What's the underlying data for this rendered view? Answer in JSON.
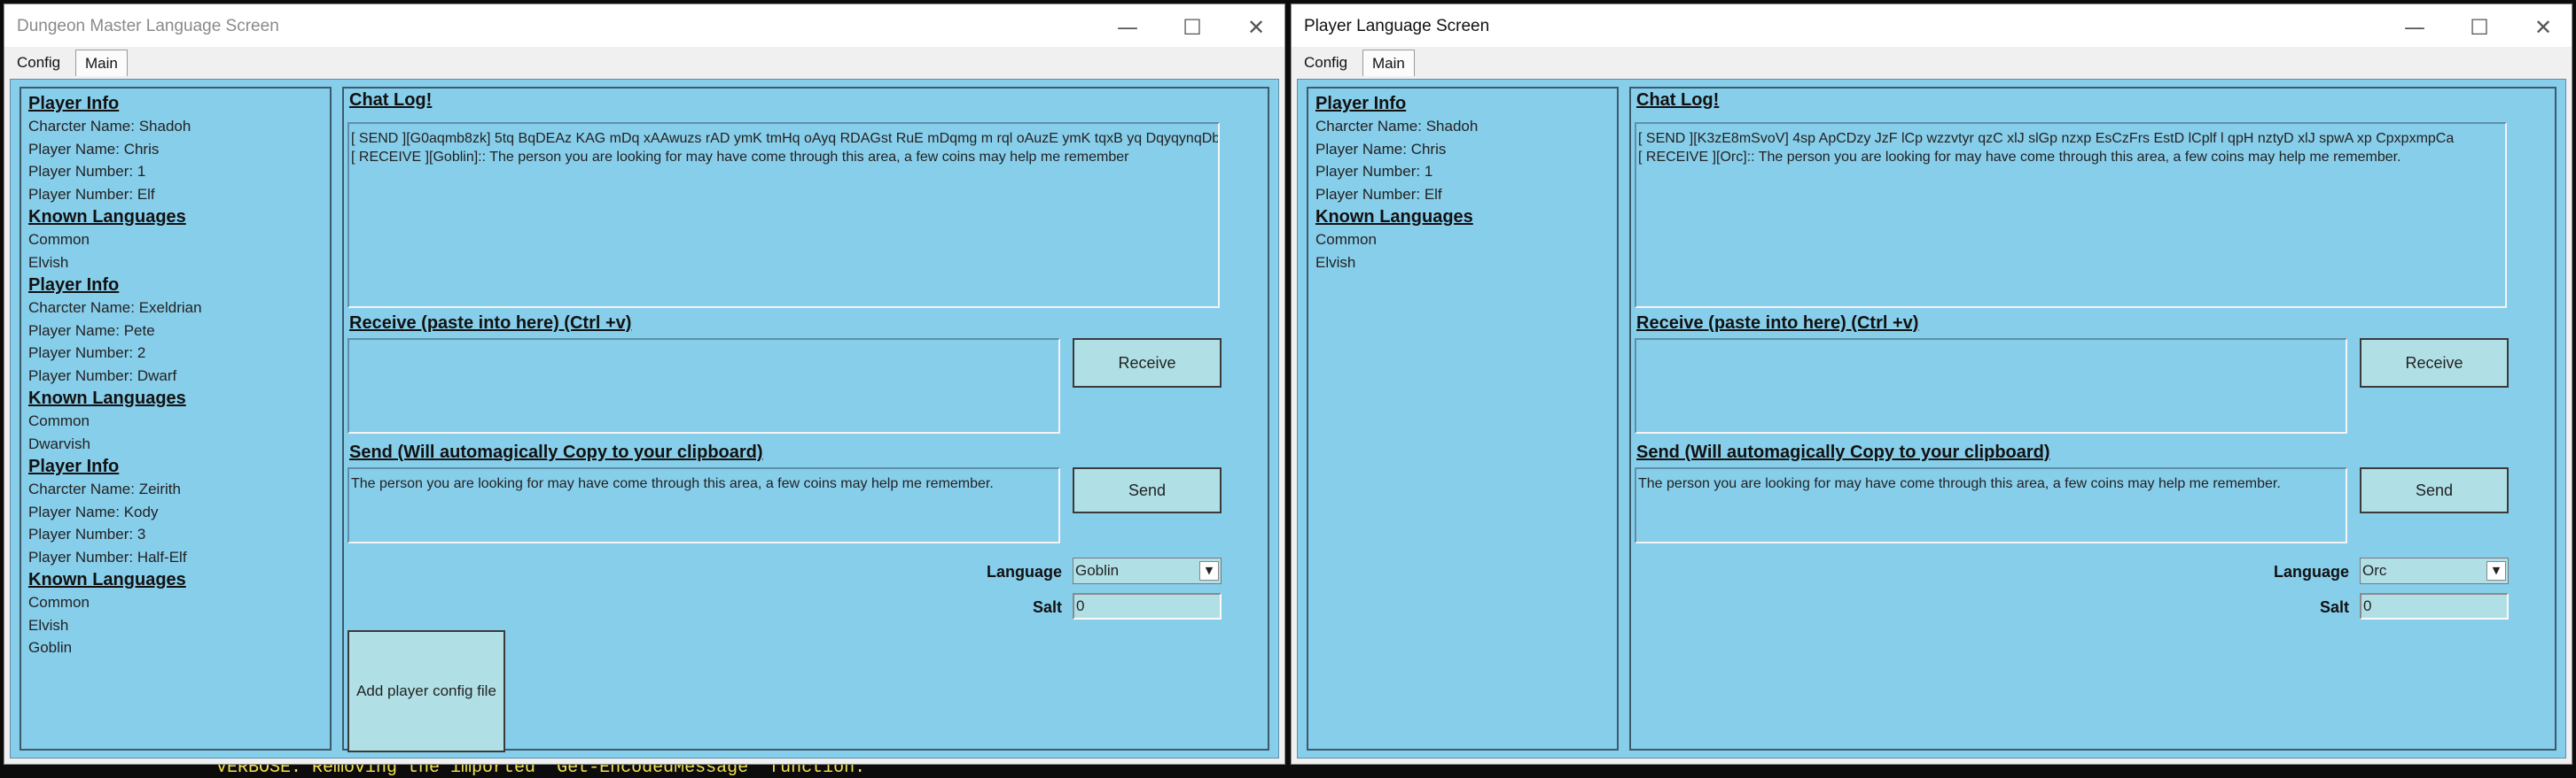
{
  "background_console_text": "VERBOSE: Removing the imported \"Get-EncodedMessage\" function.",
  "dm_window": {
    "title": "Dungeon Master Language Screen",
    "controls": {
      "minimize": "—",
      "maximize": "☐",
      "close": "✕"
    },
    "tabs": {
      "config": "Config",
      "main": "Main"
    },
    "players": [
      {
        "heading": "Player Info",
        "charname": "Charcter Name: Shadoh",
        "playername": "Player Name: Chris",
        "playernumber": "Player Number: 1",
        "race": "Player Number: Elf",
        "lang_heading": "Known Languages",
        "languages": [
          "Common",
          "Elvish"
        ]
      },
      {
        "heading": "Player Info",
        "charname": "Charcter Name: Exeldrian",
        "playername": "Player Name: Pete",
        "playernumber": "Player Number: 2",
        "race": "Player Number: Dwarf",
        "lang_heading": "Known Languages",
        "languages": [
          "Common",
          "Dwarvish"
        ]
      },
      {
        "heading": "Player Info",
        "charname": "Charcter Name: Zeirith",
        "playername": "Player Name: Kody",
        "playernumber": "Player Number: 3",
        "race": "Player Number: Half-Elf",
        "lang_heading": "Known Languages",
        "languages": [
          "Common",
          "Elvish",
          "Goblin"
        ]
      }
    ],
    "chat_label": "Chat Log!",
    "chat_lines": [
      "[ SEND ][G0aqmb8zk] 5tq BqDEAz KAG mDq xAAwuzs rAD ymK tmHq oAyq RDAGst RuE mDqmg m rql oAuzE ymK tqxB yq DqyqynqDb",
      "[ RECEIVE ][Goblin]::  The person you are looking for may have come through this area, a few coins may help me remember"
    ],
    "receive_label": "Receive (paste into here) (Ctrl +v)",
    "receive_button": "Receive",
    "send_label": "Send     (Will automagically Copy to your clipboard)",
    "send_text": "The person you are looking for may have come through this area, a few coins may help me remember.",
    "send_button": "Send",
    "language_label": "Language",
    "language_value": "Goblin",
    "salt_label": "Salt",
    "salt_value": "0",
    "add_button": "Add player config file"
  },
  "player_window": {
    "title": "Player Language Screen",
    "controls": {
      "minimize": "—",
      "maximize": "☐",
      "close": "✕"
    },
    "tabs": {
      "config": "Config",
      "main": "Main"
    },
    "players": [
      {
        "heading": "Player Info",
        "charname": "Charcter Name: Shadoh",
        "playername": "Player Name: Chris",
        "playernumber": "Player Number: 1",
        "race": "Player Number: Elf",
        "lang_heading": "Known Languages",
        "languages": [
          "Common",
          "Elvish"
        ]
      }
    ],
    "chat_label": "Chat Log!",
    "chat_lines": [
      "[ SEND ][K3zE8mSvoV] 4sp ApCDzy JzF lCp wzzvtyr qzC xlJ slGp nzxp EsCzFrs EstD lCplf l qpH nztyD xlJ spwA xp CpxpxmpCa",
      "[ RECEIVE ][Orc]::  The person you are looking for may have come through this area, a few coins may help me remember."
    ],
    "receive_label": "Receive (paste into here) (Ctrl +v)",
    "receive_button": "Receive",
    "send_label": "Send     (Will automagically Copy to your clipboard)",
    "send_text": "The person you are looking for may have come through this area, a few coins may help me remember.",
    "send_button": "Send",
    "language_label": "Language",
    "language_value": "Orc",
    "salt_label": "Salt",
    "salt_value": "0"
  }
}
